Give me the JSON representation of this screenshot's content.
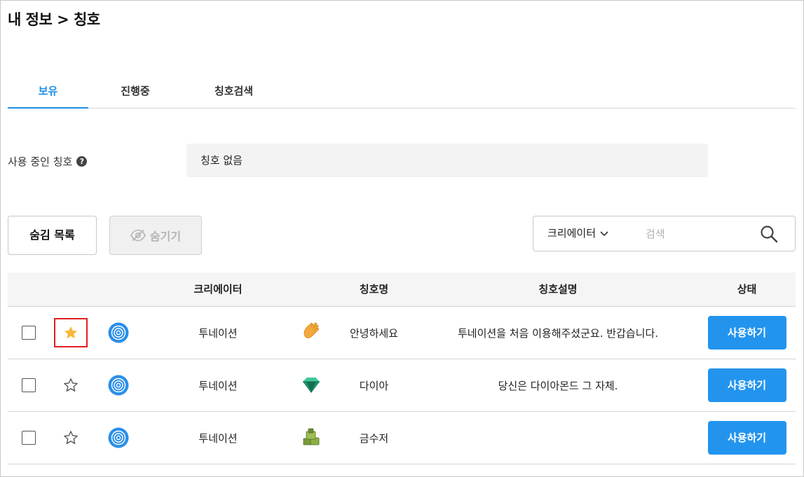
{
  "page": {
    "title": "내 정보 > 칭호"
  },
  "tabs": [
    {
      "label": "보유",
      "active": true
    },
    {
      "label": "진행중",
      "active": false
    },
    {
      "label": "칭호검색",
      "active": false
    }
  ],
  "current_title": {
    "label": "사용 중인 칭호",
    "help_icon": "question-circle-icon",
    "value": "칭호 없음"
  },
  "toolbar": {
    "hidden_list_label": "숨김 목록",
    "hide_label": "숨기기",
    "hide_icon": "eye-slash-icon",
    "search_filter": "크리에이터",
    "search_placeholder": "검색",
    "search_icon": "magnifier-icon"
  },
  "table": {
    "headers": {
      "creator": "크리에이터",
      "title_name": "칭호명",
      "title_desc": "칭호설명",
      "status": "상태"
    },
    "rows": [
      {
        "favorited": true,
        "creator": "투네이션",
        "title_icon": "waving-hand-icon",
        "title_name": "안녕하세요",
        "title_desc": "투네이션을 처음 이용해주셨군요. 반갑습니다.",
        "action": "사용하기"
      },
      {
        "favorited": false,
        "creator": "투네이션",
        "title_icon": "diamond-gem-icon",
        "title_name": "다이아",
        "title_desc": "당신은 다이아몬드 그 자체.",
        "action": "사용하기"
      },
      {
        "favorited": false,
        "creator": "투네이션",
        "title_icon": "money-stack-icon",
        "title_name": "금수저",
        "title_desc": "",
        "action": "사용하기"
      }
    ]
  },
  "colors": {
    "accent": "#1e8ee6",
    "button": "#2394ee",
    "star_active": "#f7b73b",
    "highlight_box": "#e02020"
  }
}
